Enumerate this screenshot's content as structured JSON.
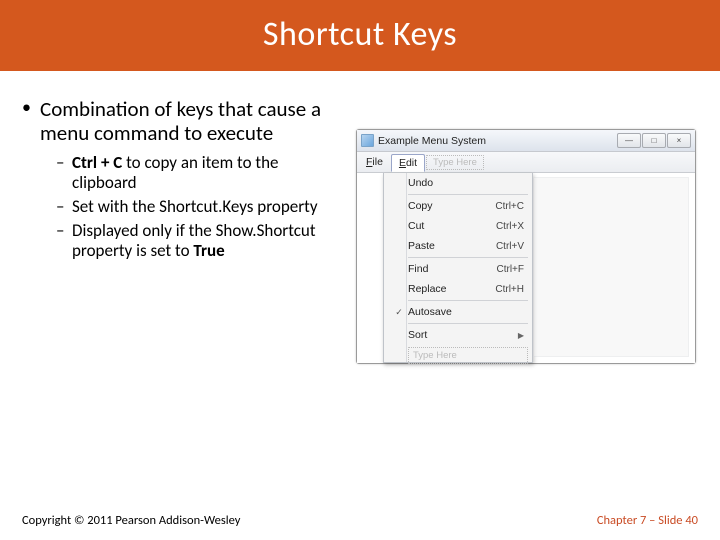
{
  "title": "Shortcut Keys",
  "main_bullet": "Combination of keys that cause a menu command to execute",
  "sub": {
    "a_pre": "Ctrl + C",
    "a_post": " to copy an item to the clipboard",
    "b_pre": "Set with the Shortcut.Keys ",
    "b_bold": "property",
    "b_actual_pre": "Set with the ",
    "b_actual_bold": "Shortcut. Keys property",
    "c_pre": "Displayed only if the ",
    "c_mid": "Show. Shortcut property",
    "c_post": " is set to ",
    "c_bold": "True"
  },
  "window": {
    "title": "Example Menu System",
    "btn_min": "—",
    "btn_max": "□",
    "btn_close": "×",
    "menu": {
      "file": "File",
      "edit": "Edit",
      "typehere": "Type Here"
    },
    "items": [
      {
        "label": "Undo",
        "shortcut": ""
      },
      {
        "sep": true
      },
      {
        "label": "Copy",
        "shortcut": "Ctrl+C"
      },
      {
        "label": "Cut",
        "shortcut": "Ctrl+X"
      },
      {
        "label": "Paste",
        "shortcut": "Ctrl+V"
      },
      {
        "sep": true
      },
      {
        "label": "Find",
        "shortcut": "Ctrl+F"
      },
      {
        "label": "Replace",
        "shortcut": "Ctrl+H"
      },
      {
        "sep": true
      },
      {
        "label": "Autosave",
        "shortcut": "",
        "checked": true
      },
      {
        "sep": true
      },
      {
        "label": "Sort",
        "shortcut": "",
        "submenu": true
      }
    ],
    "ghost": "Type Here"
  },
  "footer": {
    "copyright": "Copyright © 2011 Pearson Addison-Wesley",
    "page": "Chapter 7 – Slide 40"
  }
}
